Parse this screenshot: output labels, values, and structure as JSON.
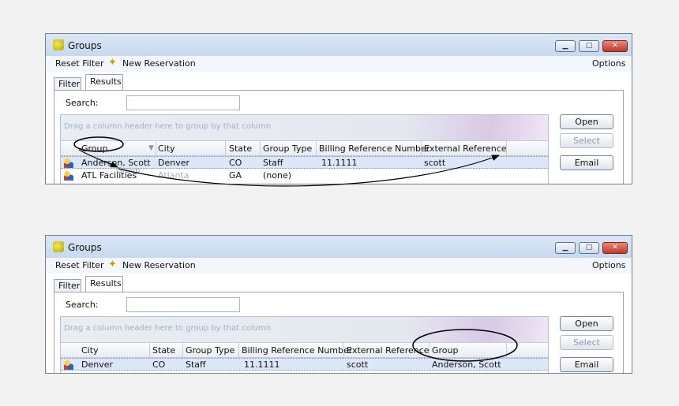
{
  "window": {
    "title": "Groups"
  },
  "menu": {
    "reset_filter": "Reset Filter",
    "new_reservation": "New Reservation",
    "options": "Options"
  },
  "titlebar_buttons": {
    "minimize": "▁",
    "maximize": "▢",
    "close": "✕"
  },
  "tabs": [
    {
      "label": "Filter"
    },
    {
      "label": "Results",
      "active": true
    }
  ],
  "search": {
    "label": "Search:",
    "value": ""
  },
  "grid": {
    "group_prompt": "Drag a column header here to group by that column"
  },
  "buttons": {
    "open": "Open",
    "select": "Select",
    "email": "Email"
  },
  "before": {
    "columns": [
      "Group",
      "City",
      "State",
      "Group Type",
      "Billing Reference Number",
      "External Reference"
    ],
    "rows": [
      {
        "group": "Anderson, Scott",
        "city": "Denver",
        "state": "CO",
        "type": "Staff",
        "billing": "11.1111",
        "external": "scott"
      },
      {
        "group": "ATL Facilities",
        "city": "Atlanta",
        "state": "GA",
        "type": "(none)",
        "billing": "",
        "external": ""
      }
    ],
    "drag_label": "Group"
  },
  "after": {
    "columns": [
      "City",
      "State",
      "Group Type",
      "Billing Reference Number",
      "External Reference",
      "Group"
    ],
    "rows": [
      {
        "city": "Denver",
        "state": "CO",
        "type": "Staff",
        "billing": "11.1111",
        "external": "scott",
        "group": "Anderson, Scott"
      }
    ]
  },
  "icons": {
    "app": "groups-app-icon",
    "wand": "magic-wand-icon",
    "row": "group-row-icon",
    "filter": "filter-icon"
  },
  "colors": {
    "annotation": "#000000",
    "selection": "#dce7f8"
  }
}
